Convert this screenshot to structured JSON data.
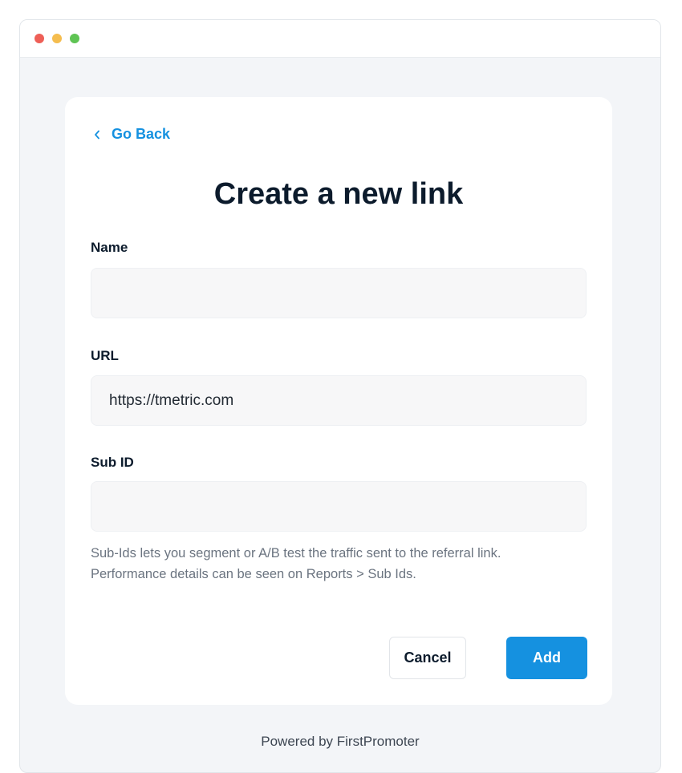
{
  "window": {
    "controls": [
      {
        "name": "close",
        "color": "#ee5f57"
      },
      {
        "name": "minimize",
        "color": "#f5bd4f"
      },
      {
        "name": "maximize",
        "color": "#5fc454"
      }
    ]
  },
  "nav": {
    "back_label": "Go Back",
    "back_icon": "chevron-left-icon"
  },
  "form": {
    "title": "Create a new link",
    "fields": {
      "name": {
        "label": "Name",
        "value": "",
        "placeholder": ""
      },
      "url": {
        "label": "URL",
        "value": "https://tmetric.com",
        "placeholder": ""
      },
      "sub_id": {
        "label": "Sub ID",
        "value": "",
        "placeholder": ""
      }
    },
    "help_line1": "Sub-Ids lets you segment or A/B test the traffic sent to the referral link.",
    "help_line2": "Performance details can be seen on Reports > Sub Ids."
  },
  "actions": {
    "cancel_label": "Cancel",
    "add_label": "Add"
  },
  "footer": {
    "text": "Powered by FirstPromoter"
  },
  "colors": {
    "accent": "#1591e0",
    "text_dark": "#0c1b2c"
  }
}
